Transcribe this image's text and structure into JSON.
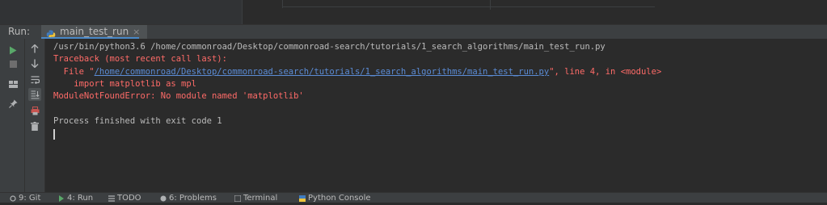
{
  "run_panel": {
    "label": "Run:",
    "tab_label": "main_test_run",
    "tab_close": "×"
  },
  "console": {
    "lines": [
      "/usr/bin/python3.6 /home/commonroad/Desktop/commonroad-search/tutorials/1_search_algorithms/main_test_run.py",
      "Traceback (most recent call last):",
      "  File \"",
      "/home/commonroad/Desktop/commonroad-search/tutorials/1_search_algorithms/main_test_run.py",
      "\", line 4, in <module>",
      "    import matplotlib as mpl",
      "ModuleNotFoundError: No module named 'matplotlib'",
      "Process finished with exit code 1"
    ]
  },
  "status_bar": {
    "items": [
      "9: Git",
      "4: Run",
      "TODO",
      "6: Problems",
      "Terminal",
      "Python Console"
    ]
  },
  "colors": {
    "background": "#2b2b2b",
    "error_text": "#ff6b68",
    "link": "#5b8cd6",
    "run_icon": "#59a869"
  }
}
